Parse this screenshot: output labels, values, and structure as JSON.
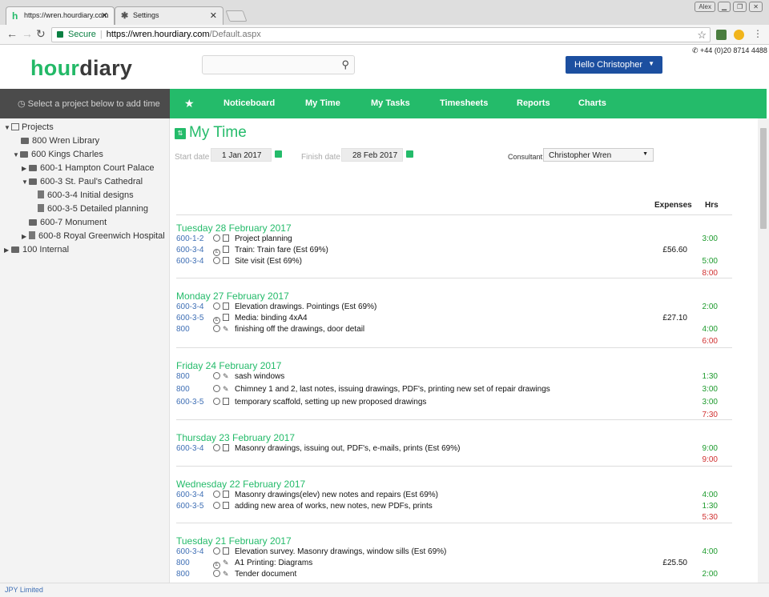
{
  "browser": {
    "tabs": [
      {
        "favicon": "h",
        "title": "https://wren.hourdiary.com"
      },
      {
        "favicon": "✱",
        "title": "Settings"
      }
    ],
    "secure_label": "Secure",
    "url_host": "https://wren.hourdiary.com",
    "url_path": "/Default.aspx",
    "user_chip": "Alex"
  },
  "header": {
    "logo_part1": "hour",
    "logo_part2": "diary",
    "phone": "+44 (0)20 8714 4488",
    "hello_button": "Hello Christopher"
  },
  "sidebar": {
    "prompt": "Select a project below to add time",
    "tree": [
      {
        "label": "Projects",
        "toggle": "▼",
        "icon": "computer"
      },
      {
        "label": "800 Wren Library",
        "toggle": "",
        "icon": "folder"
      },
      {
        "label": "600 Kings Charles",
        "toggle": "▼",
        "icon": "folder-open"
      },
      {
        "label": "600-1 Hampton Court Palace",
        "toggle": "▶",
        "icon": "folder"
      },
      {
        "label": "600-3 St. Paul's Cathedral",
        "toggle": "▼",
        "icon": "folder-open"
      },
      {
        "label": "600-3-4 Initial designs",
        "toggle": "",
        "icon": "document"
      },
      {
        "label": "600-3-5 Detailed planning",
        "toggle": "",
        "icon": "document"
      },
      {
        "label": "600-7 Monument",
        "toggle": "",
        "icon": "folder"
      },
      {
        "label": "600-8 Royal Greenwich Hospital",
        "toggle": "▶",
        "icon": "document"
      },
      {
        "label": "100 Internal",
        "toggle": "▶",
        "icon": "folder"
      }
    ]
  },
  "nav": {
    "items": [
      "Noticeboard",
      "My Time",
      "My Tasks",
      "Timesheets",
      "Reports",
      "Charts"
    ]
  },
  "main": {
    "title": "My Time",
    "start_label": "Start date",
    "start_value": "1 Jan 2017",
    "finish_label": "Finish date",
    "finish_value": "28 Feb 2017",
    "consultant_label": "Consultant:",
    "consultant_value": "Christopher Wren",
    "col_expenses": "Expenses",
    "col_hrs": "Hrs"
  },
  "days": [
    {
      "title": "Tuesday 28 February 2017",
      "total": "8:00",
      "entries": [
        {
          "code": "600-1-2",
          "type": "sheet",
          "desc": "Project planning",
          "exp": "",
          "hrs": "3:00"
        },
        {
          "code": "600-3-4",
          "type": "expense",
          "desc": "Train: Train fare  (Est 69%)",
          "exp": "£56.60",
          "hrs": ""
        },
        {
          "code": "600-3-4",
          "type": "sheet",
          "desc": "Site visit  (Est 69%)",
          "exp": "",
          "hrs": "5:00"
        }
      ]
    },
    {
      "title": "Monday 27 February 2017",
      "total": "6:00",
      "entries": [
        {
          "code": "600-3-4",
          "type": "sheet",
          "desc": "Elevation drawings. Pointings  (Est 69%)",
          "exp": "",
          "hrs": "2:00"
        },
        {
          "code": "600-3-5",
          "type": "expense",
          "desc": "Media: binding 4xA4",
          "exp": "£27.10",
          "hrs": ""
        },
        {
          "code": "800",
          "type": "pencil",
          "desc": "finishing off the drawings, door detail",
          "exp": "",
          "hrs": "4:00"
        }
      ]
    },
    {
      "title": "Friday 24 February 2017",
      "total": "7:30",
      "entries": [
        {
          "code": "800",
          "type": "pencil",
          "desc": "sash windows",
          "exp": "",
          "hrs": "1:30"
        },
        {
          "code": "800",
          "type": "pencil",
          "desc": "Chimney 1 and 2, last notes, issuing drawings, PDF's, printing new set of repair drawings",
          "exp": "",
          "hrs": "3:00"
        },
        {
          "code": "600-3-5",
          "type": "sheet",
          "desc": "temporary scaffold, setting up new proposed drawings",
          "exp": "",
          "hrs": "3:00"
        }
      ]
    },
    {
      "title": "Thursday 23 February 2017",
      "total": "9:00",
      "entries": [
        {
          "code": "600-3-4",
          "type": "sheet",
          "desc": "Masonry drawings, issuing out, PDF's, e-mails, prints  (Est 69%)",
          "exp": "",
          "hrs": "9:00"
        }
      ]
    },
    {
      "title": "Wednesday 22 February 2017",
      "total": "5:30",
      "entries": [
        {
          "code": "600-3-4",
          "type": "sheet",
          "desc": "Masonry drawings(elev) new notes and repairs  (Est 69%)",
          "exp": "",
          "hrs": "4:00"
        },
        {
          "code": "600-3-5",
          "type": "sheet",
          "desc": "adding new area of works, new notes, new PDFs, prints",
          "exp": "",
          "hrs": "1:30"
        }
      ]
    },
    {
      "title": "Tuesday 21 February 2017",
      "total": "",
      "entries": [
        {
          "code": "600-3-4",
          "type": "sheet",
          "desc": "Elevation survey. Masonry drawings, window sills  (Est 69%)",
          "exp": "",
          "hrs": "4:00"
        },
        {
          "code": "800",
          "type": "expense-pencil",
          "desc": "A1 Printing: Diagrams",
          "exp": "£25.50",
          "hrs": ""
        },
        {
          "code": "800",
          "type": "pencil",
          "desc": "Tender document",
          "exp": "",
          "hrs": "2:00"
        }
      ]
    }
  ],
  "footer": {
    "company": "JPY Limited"
  },
  "colors": {
    "brand_green": "#24bb6a",
    "hello_blue": "#1c4fa0",
    "sidebar_dark": "#4b4b4b",
    "total_red": "#d03030",
    "hours_green": "#1c9a2c"
  }
}
